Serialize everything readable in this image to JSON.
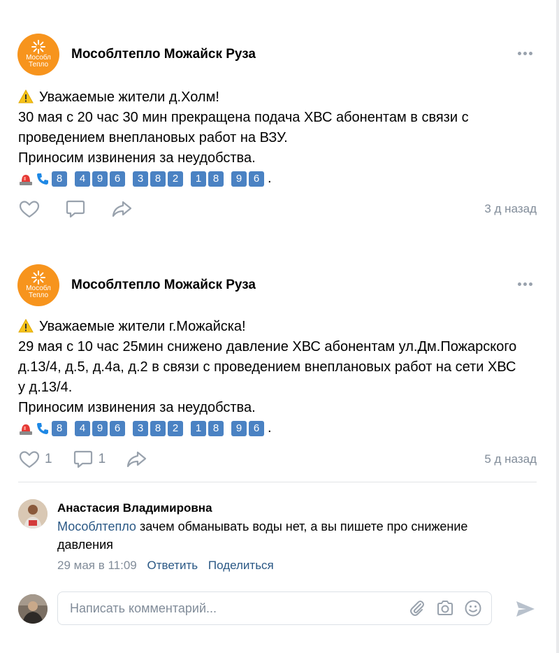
{
  "posts": [
    {
      "author": "Мособлтепло Можайск Руза",
      "logo_line1": "Мособл",
      "logo_line2": "Тепло",
      "lines": [
        "Уважаемые жители д.Холм!",
        "30 мая с 20 час 30 мин прекращена подача ХВС абонентам в связи с",
        "проведением внеплановых работ на ВЗУ.",
        "Приносим извинения за неудобства."
      ],
      "phone_digits": [
        "8",
        "4",
        "9",
        "6",
        "3",
        "8",
        "2",
        "1",
        "8",
        "9",
        "6"
      ],
      "phone_end": ".",
      "likes": "",
      "comments": "",
      "time": "3 д назад"
    },
    {
      "author": "Мособлтепло Можайск Руза",
      "logo_line1": "Мособл",
      "logo_line2": "Тепло",
      "lines": [
        "Уважаемые жители г.Можайска!",
        "29 мая с 10 час 25мин снижено давление ХВС абонентам ул.Дм.Пожарского",
        "д.13/4, д.5, д.4а, д.2 в связи с проведением внеплановых работ на сети ХВС",
        "у д.13/4.",
        "Приносим извинения за неудобства."
      ],
      "phone_digits": [
        "8",
        "4",
        "9",
        "6",
        "3",
        "8",
        "2",
        "1",
        "8",
        "9",
        "6"
      ],
      "phone_end": ".",
      "likes": "1",
      "comments": "1",
      "time": "5 д назад"
    }
  ],
  "comment": {
    "name": "Анастасия Владимировна",
    "mention": "Мособлтепло",
    "text_line1": " зачем обманывать воды нет, а вы пишете про снижение",
    "text_line2": "давления",
    "date": "29 мая в 11:09",
    "reply": "Ответить",
    "share": "Поделиться"
  },
  "compose": {
    "placeholder": "Написать комментарий..."
  },
  "colors": {
    "brand": "#f7941d",
    "link": "#2a5885",
    "muted": "#818c99",
    "digit_key": "#4a82c3"
  },
  "icons": [
    "more-icon",
    "warning-icon",
    "siren-icon",
    "phone-icon",
    "heart-icon",
    "comment-icon",
    "share-icon",
    "paperclip-icon",
    "camera-icon",
    "smile-icon",
    "send-icon"
  ]
}
